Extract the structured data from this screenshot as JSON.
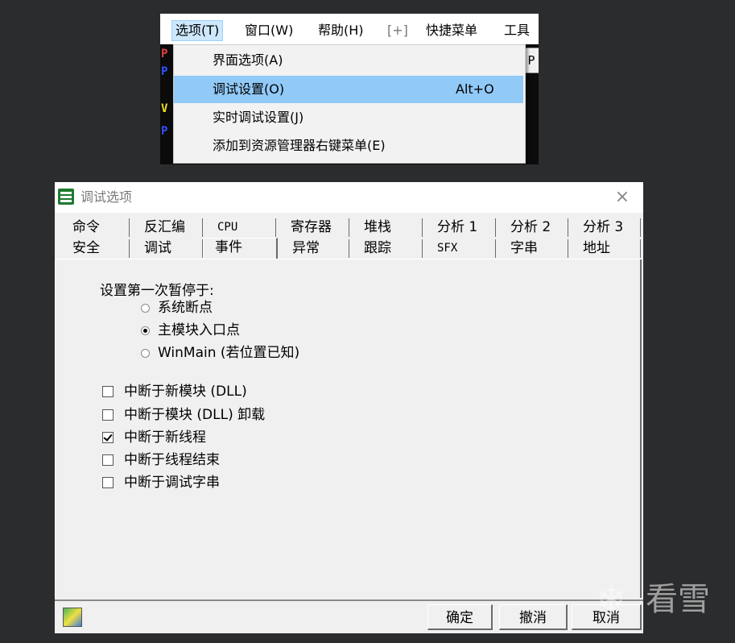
{
  "menu": {
    "bar": [
      "选项(T)",
      "窗口(W)",
      "帮助(H)",
      "[+]",
      "快捷菜单",
      "工具"
    ],
    "dropdown": [
      {
        "label": "界面选项(A)",
        "accel": ""
      },
      {
        "label": "调试设置(O)",
        "accel": "Alt+O"
      },
      {
        "label": "实时调试设置(J)",
        "accel": ""
      },
      {
        "label": "添加到资源管理器右键菜单(E)",
        "accel": ""
      }
    ],
    "background_glyphs": [
      "P",
      "P",
      "V",
      "P"
    ],
    "background_right_glyph": "P"
  },
  "dialog": {
    "title": "调试选项",
    "close_glyph": "×",
    "tabs_row1": [
      "命令",
      "反汇编",
      "CPU",
      "寄存器",
      "堆栈",
      "分析 1",
      "分析 2",
      "分析 3"
    ],
    "tabs_row2": [
      "安全",
      "调试",
      "事件",
      "异常",
      "跟踪",
      "SFX",
      "字串",
      "地址"
    ],
    "active_tab": "事件",
    "group_label": "设置第一次暂停于:",
    "radios": [
      {
        "label": "系统断点",
        "checked": false
      },
      {
        "label": "主模块入口点",
        "checked": true
      },
      {
        "label": "WinMain (若位置已知)",
        "checked": false
      }
    ],
    "checkboxes": [
      {
        "label": "中断于新模块 (DLL)",
        "checked": false
      },
      {
        "label": "中断于模块 (DLL) 卸载",
        "checked": false
      },
      {
        "label": "中断于新线程",
        "checked": true
      },
      {
        "label": "中断于线程结束",
        "checked": false
      },
      {
        "label": "中断于调试字串",
        "checked": false
      }
    ],
    "buttons": {
      "ok": "确定",
      "cancel": "撤消",
      "close": "取消"
    }
  },
  "watermark": {
    "text": "看雪",
    "glyph": "❄"
  }
}
